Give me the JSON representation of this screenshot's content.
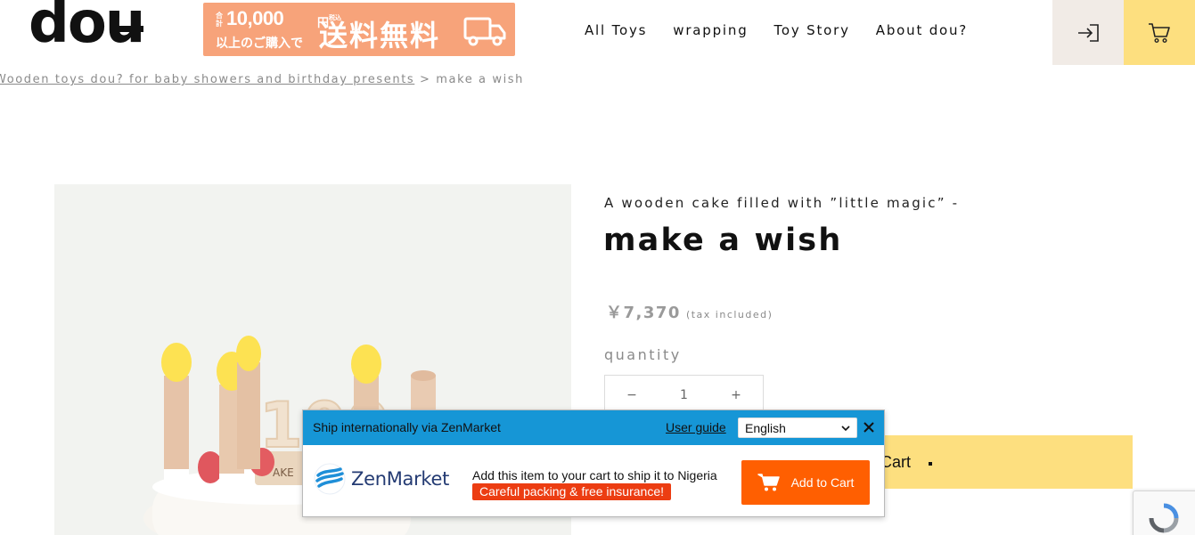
{
  "header": {
    "logo_text": "dou",
    "banner": {
      "small_label": "合計",
      "amount": "10,000",
      "yen": "円",
      "tax_note": "税込",
      "sub": "以上のご購入で",
      "big": "送料無料"
    },
    "nav": [
      "All Toys",
      "wrapping",
      "Toy Story",
      "About dou?"
    ],
    "icons": {
      "login": "login-icon",
      "cart": "cart-icon"
    },
    "colors": {
      "login_bg": "#f1ebe6",
      "cart_bg": "#fddf7f",
      "banner_bg": "#f7a37a"
    }
  },
  "breadcrumb": {
    "link": "Wooden toys dou? for baby showers and birthday presents",
    "separator": ">",
    "current": "make a wish"
  },
  "product": {
    "catch": "A wooden cake filled with ”little magic” -",
    "title": "make a wish",
    "price": "￥7,370",
    "tax_note": "(tax included)",
    "quantity_label": "quantity",
    "quantity": {
      "minus": "−",
      "value": "1",
      "plus": "+"
    },
    "add_to_cart_partial": "Cart",
    "image_text": "100",
    "image_tag": "AKE"
  },
  "zenmarket": {
    "title": "Ship internationally via ZenMarket",
    "user_guide": "User guide",
    "language": "English",
    "close": "×",
    "logo_text": "ZenMarket",
    "message": "Add this item to your cart to ship it to Nigeria",
    "badge": "Careful packing & free insurance!",
    "add_button": "Add to Cart",
    "colors": {
      "bar": "#1696d6",
      "button": "#ff5f01",
      "badge": "#ec3d12"
    }
  }
}
